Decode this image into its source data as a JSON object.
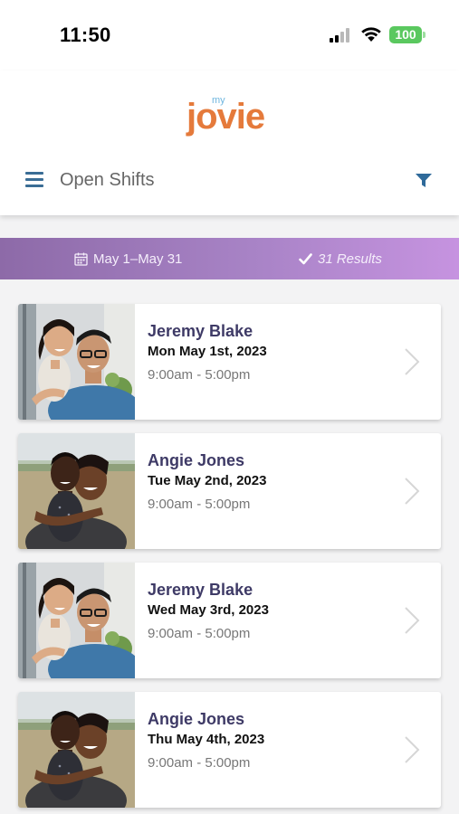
{
  "status_bar": {
    "time": "11:50",
    "battery": "100",
    "icons": [
      "signal-icon",
      "wifi-icon",
      "battery-icon"
    ]
  },
  "header": {
    "logo_small": "my",
    "logo_main": "jovie",
    "title": "Open Shifts",
    "icons": [
      "menu-icon",
      "filter-icon"
    ]
  },
  "colors": {
    "brand_orange": "#e57a3b",
    "brand_blue": "#6fb6df",
    "accent_blue": "#3a6d95",
    "banner_start": "#8d6aa8",
    "banner_end": "#c693e0",
    "name_color": "#3e3a66"
  },
  "results": {
    "date_range": "May 1–May 31",
    "count_label": "31 Results",
    "icons": [
      "calendar-icon",
      "check-icon"
    ]
  },
  "shifts": [
    {
      "name": "Jeremy Blake",
      "date": "Mon May 1st, 2023",
      "time": "9:00am - 5:00pm",
      "photo": "father-daughter-photo"
    },
    {
      "name": "Angie Jones",
      "date": "Tue May 2nd, 2023",
      "time": "9:00am - 5:00pm",
      "photo": "mother-son-photo"
    },
    {
      "name": "Jeremy Blake",
      "date": "Wed May 3rd, 2023",
      "time": "9:00am - 5:00pm",
      "photo": "father-daughter-photo"
    },
    {
      "name": "Angie Jones",
      "date": "Thu May 4th, 2023",
      "time": "9:00am - 5:00pm",
      "photo": "mother-son-photo"
    }
  ]
}
